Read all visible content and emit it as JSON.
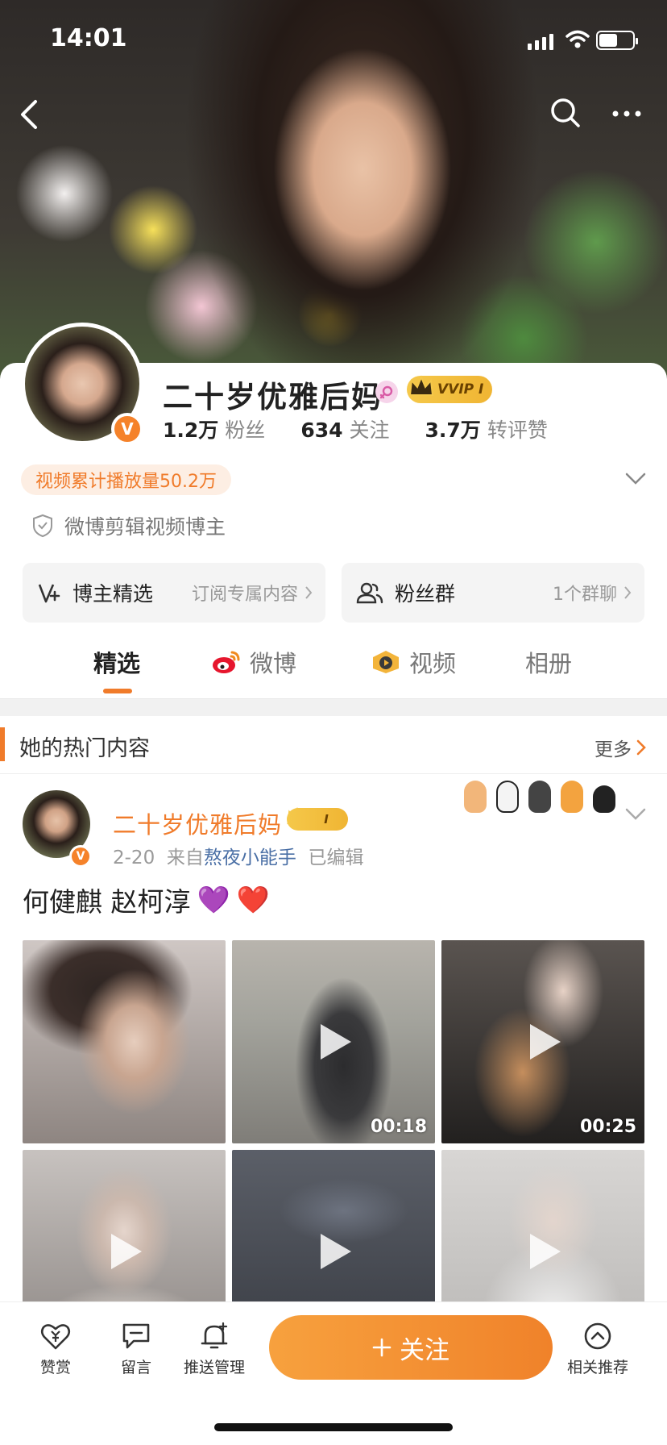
{
  "status": {
    "time": "14:01"
  },
  "profile": {
    "name": "二十岁优雅后妈",
    "verified_mark": "V",
    "vip_label": "VVIP I",
    "stats": [
      {
        "value": "1.2万",
        "label": "粉丝"
      },
      {
        "value": "634",
        "label": "关注"
      },
      {
        "value": "3.7万",
        "label": "转评赞"
      }
    ],
    "video_play_tag": "视频累计播放量50.2万",
    "verification": "微博剪辑视频博主"
  },
  "features": {
    "picks": {
      "title": "博主精选",
      "sub": "订阅专属内容"
    },
    "fans": {
      "title": "粉丝群",
      "sub": "1个群聊"
    }
  },
  "tabs": [
    "精选",
    "微博",
    "视频",
    "相册"
  ],
  "hot": {
    "title": "她的热门内容",
    "more": "更多"
  },
  "post": {
    "author": "二十岁优雅后妈",
    "badge": "I",
    "date": "2-20",
    "from_prefix": "来自",
    "source": "熬夜小能手",
    "edited": "已编辑",
    "text": "何健麒 赵柯淳",
    "emoji": [
      "💜",
      "❤️"
    ],
    "media": [
      {
        "video": false,
        "duration": ""
      },
      {
        "video": true,
        "duration": "00:18"
      },
      {
        "video": true,
        "duration": "00:25"
      },
      {
        "video": true,
        "duration": ""
      },
      {
        "video": true,
        "duration": ""
      },
      {
        "video": true,
        "duration": ""
      }
    ]
  },
  "bottom": {
    "reward": "赞赏",
    "message": "留言",
    "push": "推送管理",
    "follow": "关注",
    "related": "相关推荐"
  },
  "colors": {
    "accent": "#f07b2a",
    "vip_gold": "#f0b533",
    "link": "#4a6fa5"
  }
}
